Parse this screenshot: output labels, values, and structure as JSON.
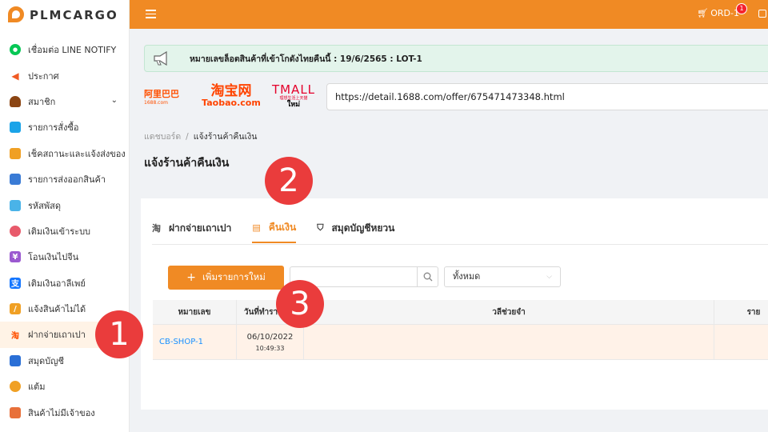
{
  "sidebar": {
    "logo": "PLMCARGO",
    "items": [
      {
        "label": "เชื่อมต่อ LINE NOTIFY",
        "icon": "line-icon"
      },
      {
        "label": "ประกาศ",
        "icon": "megaphone-icon"
      },
      {
        "label": "สมาชิก",
        "icon": "member-icon"
      },
      {
        "label": "รายการสั่งซื้อ",
        "icon": "order-list-icon"
      },
      {
        "label": "เช็คสถานะและแจ้งส่งของ",
        "icon": "truck-icon"
      },
      {
        "label": "รายการส่งออกสินค้า",
        "icon": "export-icon"
      },
      {
        "label": "รหัสพัสดุ",
        "icon": "parcel-icon"
      },
      {
        "label": "เติมเงินเข้าระบบ",
        "icon": "piggy-bank-icon"
      },
      {
        "label": "โอนเงินไปจีน",
        "icon": "yuan-icon"
      },
      {
        "label": "เติมเงินอาลีเพย์",
        "icon": "alipay-icon"
      },
      {
        "label": "แจ้งสินค้าไม่ได้",
        "icon": "not-received-icon"
      },
      {
        "label": "ฝากจ่ายเถาเปา",
        "icon": "taobao-icon"
      },
      {
        "label": "สมุดบัญชี",
        "icon": "wallet-icon"
      },
      {
        "label": "แต้ม",
        "icon": "points-icon"
      },
      {
        "label": "สินค้าไม่มีเจ้าของ",
        "icon": "unclaimed-icon"
      }
    ]
  },
  "topbar": {
    "cart_label": "ORD-1",
    "cart_badge": "1"
  },
  "notice": {
    "text": "หมายเลขล็อตสินค้าที่เข้าโกดังไทยคืนนี้ : 19/6/2565 : LOT-1"
  },
  "shops": {
    "alibaba_cn": "阿里巴巴",
    "alibaba_sub": "1688.com",
    "taobao_cn": "淘宝网",
    "taobao_en": "Taobao.com",
    "tmall": "TMALL",
    "tmall_sub": "理想生活上天猫",
    "tmall_tag": "ใหม่"
  },
  "url_input": {
    "value": "https://detail.1688.com/offer/675471473348.html"
  },
  "breadcrumb": {
    "home": "แดชบอร์ด",
    "separator": "/",
    "current": "แจ้งร้านค้าคืนเงิน"
  },
  "page": {
    "title": "แจ้งร้านค้าคืนเงิน"
  },
  "tabs": [
    {
      "label": "ฝากจ่ายเถาเปา",
      "icon": "taobao-icon"
    },
    {
      "label": "คืนเงิน",
      "icon": "refund-icon"
    },
    {
      "label": "สมุดบัญชีหยวน",
      "icon": "yuan-shield-icon"
    }
  ],
  "toolbar": {
    "add_label": "เพิ่มรายการใหม่",
    "filter_value": "ทั้งหมด"
  },
  "table": {
    "headers": [
      "หมายเลข",
      "วันที่ทำรายการ",
      "วลีช่วยจำ",
      "ราย"
    ],
    "rows": [
      {
        "number": "CB-SHOP-1",
        "date": "06/10/2022",
        "time": "10:49:33",
        "memo": "",
        "amount": ""
      }
    ]
  },
  "steps": [
    "1",
    "2",
    "3"
  ],
  "colors": {
    "accent": "#f08a24",
    "step": "#ea3c3c",
    "link": "#1890ff"
  }
}
